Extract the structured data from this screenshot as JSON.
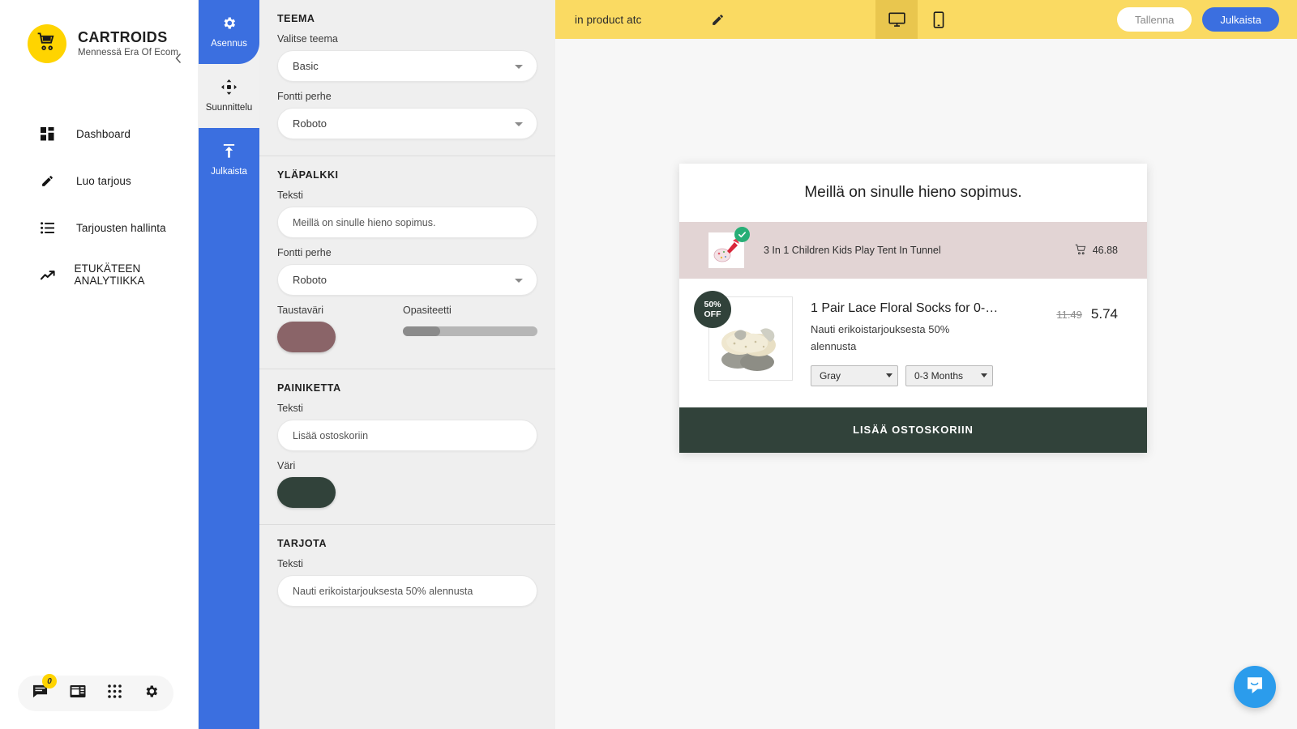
{
  "brand": {
    "title": "CARTROIDS",
    "subtitle": "Mennessä Era Of Ecom",
    "logo_icon": "shopping-cart-icon",
    "logo_bg": "#ffd400",
    "collapse_icon": "chevron-left-icon"
  },
  "nav": {
    "items": [
      {
        "label": "Dashboard",
        "icon": "dashboard-grid-icon"
      },
      {
        "label": "Luo tarjous",
        "icon": "pencil-icon"
      },
      {
        "label": "Tarjousten hallinta",
        "icon": "list-icon"
      },
      {
        "label": "ETUKÄTEEN ANALYTIIKKA",
        "icon": "trending-up-icon"
      }
    ]
  },
  "dock": {
    "items": [
      {
        "icon": "chat-bubble-icon",
        "badge": "0"
      },
      {
        "icon": "news-article-icon",
        "badge": ""
      },
      {
        "icon": "apps-grid-icon",
        "badge": ""
      },
      {
        "icon": "gear-icon",
        "badge": ""
      }
    ],
    "badge_color": "#ffd400"
  },
  "rail": {
    "tabs": [
      {
        "label": "Asennus",
        "icon": "gear-icon",
        "active": true
      },
      {
        "label": "Suunnittelu",
        "icon": "move-arrows-icon",
        "active": false
      },
      {
        "label": "Julkaista",
        "icon": "upload-icon",
        "active": true
      }
    ],
    "active_color": "#3b6fe0"
  },
  "panel": {
    "sections": [
      {
        "title": "TEEMA",
        "fields": [
          {
            "label": "Valitse teema",
            "type": "select",
            "value": "Basic"
          },
          {
            "label": "Fontti perhe",
            "type": "select",
            "value": "Roboto"
          }
        ]
      },
      {
        "title": "YLÄPALKKI",
        "fields": [
          {
            "label": "Teksti",
            "type": "text",
            "value": "Meillä on sinulle hieno sopimus."
          },
          {
            "label": "Fontti perhe",
            "type": "select",
            "value": "Roboto"
          }
        ],
        "color_label": "Taustaväri",
        "color_value": "#8a6468",
        "opacity_label": "Opasiteetti",
        "opacity_percent": 28
      },
      {
        "title": "PAINIKETTA",
        "fields": [
          {
            "label": "Teksti",
            "type": "text",
            "value": "Lisää ostoskoriin"
          }
        ],
        "color_label": "Väri",
        "color_value": "#31423a"
      },
      {
        "title": "TARJOTA",
        "fields": [
          {
            "label": "Teksti",
            "type": "text",
            "value": "Nauti erikoistarjouksesta 50% alennusta"
          }
        ]
      }
    ]
  },
  "topbar": {
    "campaign_name": "in product atc",
    "edit_icon": "pencil-icon",
    "bg_color": "#fada62",
    "devices": [
      {
        "icon": "desktop-icon",
        "active": true
      },
      {
        "icon": "mobile-icon",
        "active": false
      }
    ],
    "save_label": "Tallenna",
    "publish_label": "Julkaista"
  },
  "preview": {
    "headline": "Meillä on sinulle hieno sopimus.",
    "header_bg": "#e2d4d4",
    "cart_item": {
      "title": "3 In 1 Children Kids Play Tent In Tunnel",
      "price": "46.88",
      "cart_icon": "shopping-cart-icon",
      "check_icon": "check-circle-icon"
    },
    "offer_item": {
      "badge_top": "50%",
      "badge_bottom": "OFF",
      "title": "1 Pair Lace Floral Socks for 0-1…",
      "description": "Nauti erikoistarjouksesta 50% alennusta",
      "variant_color": "Gray",
      "variant_size": "0-3 Months",
      "price_old": "11.49",
      "price_new": "5.74"
    },
    "cta_label": "LISÄÄ OSTOSKORIIN",
    "cta_color": "#31423a"
  },
  "intercom": {
    "icon": "intercom-chat-icon",
    "color": "#2b9cec"
  }
}
